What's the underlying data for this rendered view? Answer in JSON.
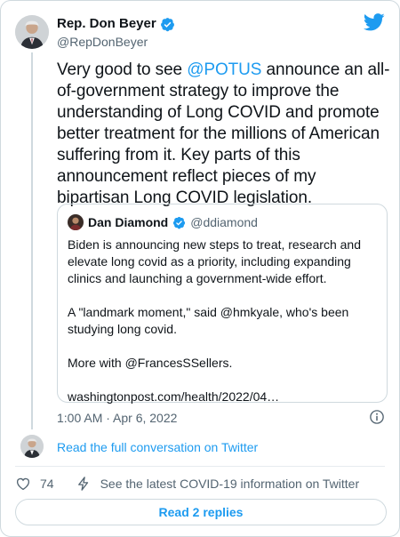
{
  "author": {
    "name": "Rep. Don Beyer",
    "handle": "@RepDonBeyer"
  },
  "tweet": {
    "text_1": "Very good to see ",
    "mention": "@POTUS",
    "text_2": " announce an all-of-government strategy to improve the understanding of Long COVID and promote better treatment for the millions of American suffering from it. Key parts of this announcement reflect pieces of my bipartisan Long COVID legislation."
  },
  "quote": {
    "name": "Dan Diamond",
    "handle": "@ddiamond",
    "paragraphs": [
      "Biden is announcing new steps to treat, research and elevate long covid as a priority, including expanding clinics and launching a government-wide effort.",
      "A \"landmark moment,\" said @hmkyale, who's been studying long covid.",
      "More with @FrancesSSellers.",
      "washingtonpost.com/health/2022/04…"
    ]
  },
  "timestamp": "1:00 AM · Apr 6, 2022",
  "read_conversation": "Read the full conversation on Twitter",
  "actions": {
    "like_count": "74",
    "covid_info": "See the latest COVID-19 information on Twitter"
  },
  "replies_button": "Read 2 replies",
  "colors": {
    "accent": "#1d9bf0",
    "text": "#0f1419",
    "muted": "#536471",
    "border": "#cfd9de"
  },
  "icons": [
    "verified-badge-icon",
    "twitter-bird-icon",
    "info-icon",
    "heart-icon",
    "lightning-bolt-icon"
  ]
}
